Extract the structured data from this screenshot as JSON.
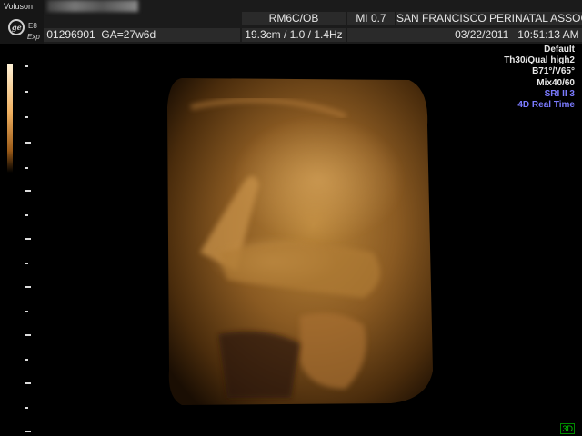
{
  "header": {
    "brand": "Voluson",
    "model": "E8",
    "probe_mode": "Exp",
    "patient_id": "01296901",
    "gestational_age": "GA=27w6d",
    "probe": "RM6C/OB",
    "mechanical_index": "MI  0.7",
    "institution": "SAN FRANCISCO PERINATAL ASSOC.",
    "depth_params": "19.3cm / 1.0 / 1.4Hz",
    "date": "03/22/2011",
    "time": "10:51:13 AM"
  },
  "settings": {
    "preset": "Default",
    "threshold": "Th30/Qual high2",
    "angles": "B71°/V65°",
    "mix": "Mix40/60",
    "sri": "SRI II 3",
    "mode": "4D Real Time"
  },
  "mode_tag": "3D",
  "colors": {
    "mode_tag": "#00d000",
    "highlight_text": "#7b7bff"
  }
}
